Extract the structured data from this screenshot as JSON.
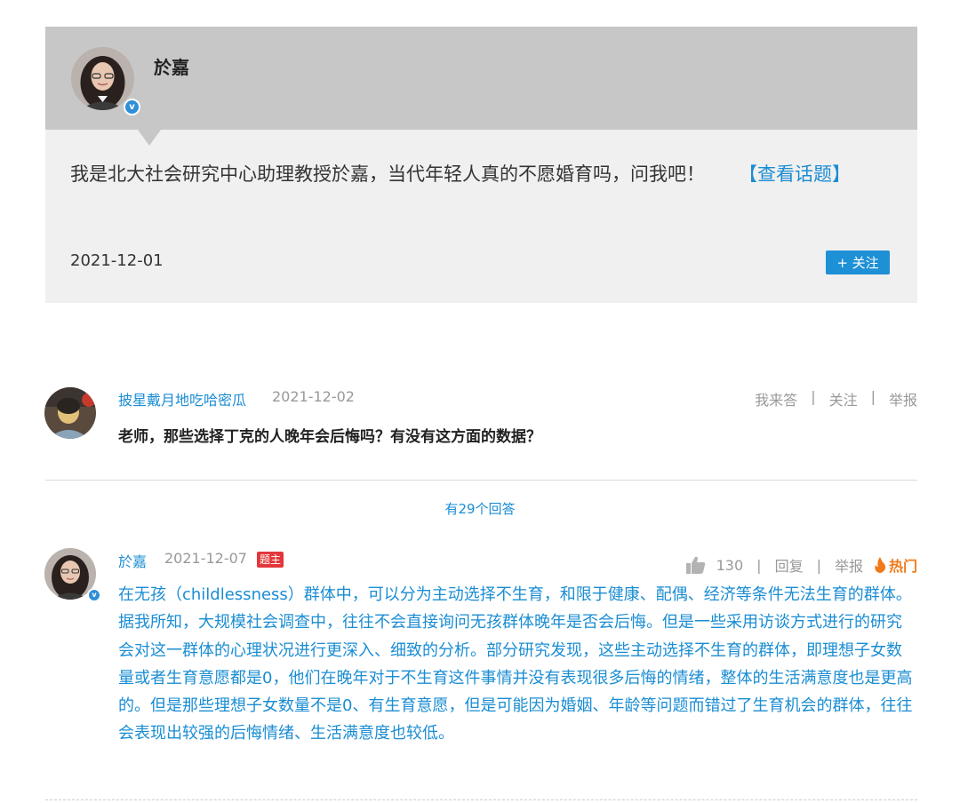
{
  "topic": {
    "author_name": "於嘉",
    "verified_badge": "v",
    "text": "我是北大社会研究中心助理教授於嘉，当代年轻人真的不愿婚育吗，问我吧！",
    "link_text": "【查看话题】",
    "date": "2021-12-01",
    "follow_label": "+ 关注"
  },
  "question": {
    "user": "披星戴月地吃哈密瓜",
    "date": "2021-12-02",
    "actions": [
      "我来答",
      "关注",
      "举报"
    ],
    "text": "老师，那些选择丁克的人晚年会后悔吗？有没有这方面的数据？"
  },
  "answer_count": "有29个回答",
  "answer": {
    "user": "於嘉",
    "verified_badge": "v",
    "date": "2021-12-07",
    "owner_badge": "题主",
    "likes": "130",
    "reply_label": "回复",
    "report_label": "举报",
    "hot_label": "热门",
    "text": "在无孩（childlessness）群体中，可以分为主动选择不生育，和限于健康、配偶、经济等条件无法生育的群体。据我所知，大规模社会调查中，往往不会直接询问无孩群体晚年是否会后悔。但是一些采用访谈方式进行的研究会对这一群体的心理状况进行更深入、细致的分析。部分研究发现，这些主动选择不生育的群体，即理想子女数量或者生育意愿都是0，他们在晚年对于不生育这件事情并没有表现很多后悔的情绪，整体的生活满意度也是更高的。但是那些理想子女数量不是0、有生育意愿，但是可能因为婚姻、年龄等问题而错过了生育机会的群体，往往会表现出较强的后悔情绪、生活满意度也较低。"
  },
  "colors": {
    "link": "#1a8dd3",
    "header_bg": "#c7c7c7",
    "card_bg": "#f0f0f0",
    "follow_bg": "#1e90d6",
    "owner_badge_bg": "#e3373b",
    "hot": "#f07a1a"
  },
  "icons": [
    "avatar",
    "verified-icon",
    "thumbs-up-icon",
    "flame-icon"
  ]
}
